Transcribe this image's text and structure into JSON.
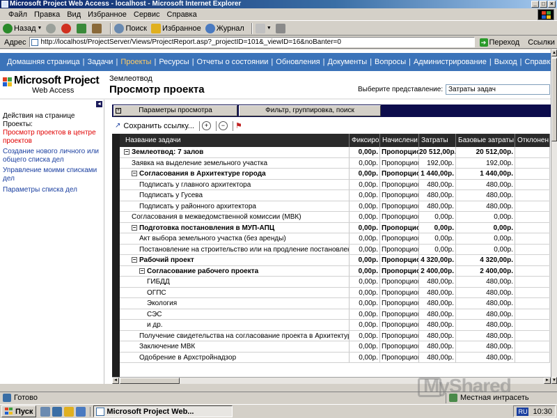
{
  "window": {
    "title": "Microsoft Project Web Access - localhost - Microsoft Internet Explorer"
  },
  "menu": [
    "Файл",
    "Правка",
    "Вид",
    "Избранное",
    "Сервис",
    "Справка"
  ],
  "toolbar": {
    "back": "Назад",
    "search": "Поиск",
    "favorites": "Избранное",
    "journal": "Журнал"
  },
  "address": {
    "label": "Адрес",
    "url": "http://localhost/ProjectServer/Views/ProjectReport.asp?_projectID=101&_viewID=16&noBanter=0",
    "go": "Переход",
    "links": "Ссылки"
  },
  "nav": {
    "items": [
      "Домашняя страница",
      "Задачи",
      "Проекты",
      "Ресурсы",
      "Отчеты о состоянии",
      "Обновления",
      "Документы",
      "Вопросы",
      "Администрирование",
      "Выход",
      "Справка"
    ],
    "active": "Проекты"
  },
  "logo": {
    "title": "Microsoft Project",
    "subtitle": "Web Access"
  },
  "page": {
    "project_name": "Землеотвод",
    "heading": "Просмотр проекта",
    "view_label": "Выберите представление:",
    "view_value": "Затраты задач"
  },
  "left_panel": {
    "title": "Действия на странице Проекты:",
    "links": [
      "Просмотр проектов в центре проектов",
      "Создание нового личного или общего списка дел",
      "Управление моими списками дел",
      "Параметры списка дел"
    ]
  },
  "tabs": {
    "view_params": "Параметры просмотра",
    "filter": "Фильтр, группировка, поиск"
  },
  "grid_toolbar": {
    "save_link": "Сохранить ссылку..."
  },
  "grid": {
    "headers": [
      "Название задачи",
      "Фиксиро",
      "Начислени",
      "Затраты",
      "Базовые затраты",
      "Отклонен"
    ],
    "rows": [
      {
        "name": "Землеотвод: 7 залов",
        "level": 0,
        "summary": true,
        "box": "−",
        "fixed": "0,00р.",
        "accrual": "Пропорцион",
        "cost": "20 512,00р.",
        "base": "20 512,00р."
      },
      {
        "name": "Заявка на выделение земельного участка",
        "level": 1,
        "summary": false,
        "box": "",
        "fixed": "0,00р.",
        "accrual": "Пропорцион",
        "cost": "192,00р.",
        "base": "192,00р."
      },
      {
        "name": "Согласования в Архитектуре города",
        "level": 1,
        "summary": true,
        "box": "−",
        "fixed": "0,00р.",
        "accrual": "Пропорцион",
        "cost": "1 440,00р.",
        "base": "1 440,00р."
      },
      {
        "name": "Подписать у главного архитектора",
        "level": 2,
        "summary": false,
        "box": "",
        "fixed": "0,00р.",
        "accrual": "Пропорцион",
        "cost": "480,00р.",
        "base": "480,00р."
      },
      {
        "name": "Подписать у Гусева",
        "level": 2,
        "summary": false,
        "box": "",
        "fixed": "0,00р.",
        "accrual": "Пропорцион",
        "cost": "480,00р.",
        "base": "480,00р."
      },
      {
        "name": "Подписать у районного архитектора",
        "level": 2,
        "summary": false,
        "box": "",
        "fixed": "0,00р.",
        "accrual": "Пропорцион",
        "cost": "480,00р.",
        "base": "480,00р."
      },
      {
        "name": "Согласования в межведомственной комиссии (МВК)",
        "level": 1,
        "summary": false,
        "box": "",
        "fixed": "0,00р.",
        "accrual": "Пропорцион",
        "cost": "0,00р.",
        "base": "0,00р."
      },
      {
        "name": "Подготовка постановления в МУП-АПЦ",
        "level": 1,
        "summary": true,
        "box": "−",
        "fixed": "0,00р.",
        "accrual": "Пропорцион",
        "cost": "0,00р.",
        "base": "0,00р."
      },
      {
        "name": "Акт выбора земельного участка (без аренды)",
        "level": 2,
        "summary": false,
        "box": "",
        "fixed": "0,00р.",
        "accrual": "Пропорцион",
        "cost": "0,00р.",
        "base": "0,00р."
      },
      {
        "name": "Постановление на строительство или на продление постановления",
        "level": 2,
        "summary": false,
        "box": "",
        "fixed": "0,00р.",
        "accrual": "Пропорцион",
        "cost": "0,00р.",
        "base": "0,00р."
      },
      {
        "name": "Рабочий проект",
        "level": 1,
        "summary": true,
        "box": "−",
        "fixed": "0,00р.",
        "accrual": "Пропорцион",
        "cost": "4 320,00р.",
        "base": "4 320,00р."
      },
      {
        "name": "Согласование рабочего проекта",
        "level": 2,
        "summary": true,
        "box": "−",
        "fixed": "0,00р.",
        "accrual": "Пропорцион",
        "cost": "2 400,00р.",
        "base": "2 400,00р."
      },
      {
        "name": "ГИБДД",
        "level": 3,
        "summary": false,
        "box": "",
        "fixed": "0,00р.",
        "accrual": "Пропорцион",
        "cost": "480,00р.",
        "base": "480,00р."
      },
      {
        "name": "ОГПС",
        "level": 3,
        "summary": false,
        "box": "",
        "fixed": "0,00р.",
        "accrual": "Пропорцион",
        "cost": "480,00р.",
        "base": "480,00р."
      },
      {
        "name": "Экология",
        "level": 3,
        "summary": false,
        "box": "",
        "fixed": "0,00р.",
        "accrual": "Пропорцион",
        "cost": "480,00р.",
        "base": "480,00р."
      },
      {
        "name": "СЭС",
        "level": 3,
        "summary": false,
        "box": "",
        "fixed": "0,00р.",
        "accrual": "Пропорцион",
        "cost": "480,00р.",
        "base": "480,00р."
      },
      {
        "name": "и др.",
        "level": 3,
        "summary": false,
        "box": "",
        "fixed": "0,00р.",
        "accrual": "Пропорцион",
        "cost": "480,00р.",
        "base": "480,00р."
      },
      {
        "name": "Получение свидетельства на согласование проекта в Архитектуре",
        "level": 2,
        "summary": false,
        "box": "",
        "fixed": "0,00р.",
        "accrual": "Пропорцион",
        "cost": "480,00р.",
        "base": "480,00р."
      },
      {
        "name": "Заключение МВК",
        "level": 2,
        "summary": false,
        "box": "",
        "fixed": "0,00р.",
        "accrual": "Пропорцион",
        "cost": "480,00р.",
        "base": "480,00р."
      },
      {
        "name": "Одобрение в Архстройнадзор",
        "level": 2,
        "summary": false,
        "box": "",
        "fixed": "0,00р.",
        "accrual": "Пропорцион",
        "cost": "480,00р.",
        "base": "480,00р."
      }
    ]
  },
  "status": {
    "done": "Готово",
    "zone": "Местная интрасеть"
  },
  "taskbar": {
    "start": "Пуск",
    "task": "Microsoft Project Web...",
    "lang": "RU",
    "clock": "10:30"
  },
  "watermark": "MyShared",
  "colors": {
    "nav_bg": "#3b73b9",
    "nav_active": "#ffcc66",
    "link": "#1a3fa0",
    "active_link": "#e00000",
    "grid_header": "#2a2a2a"
  }
}
